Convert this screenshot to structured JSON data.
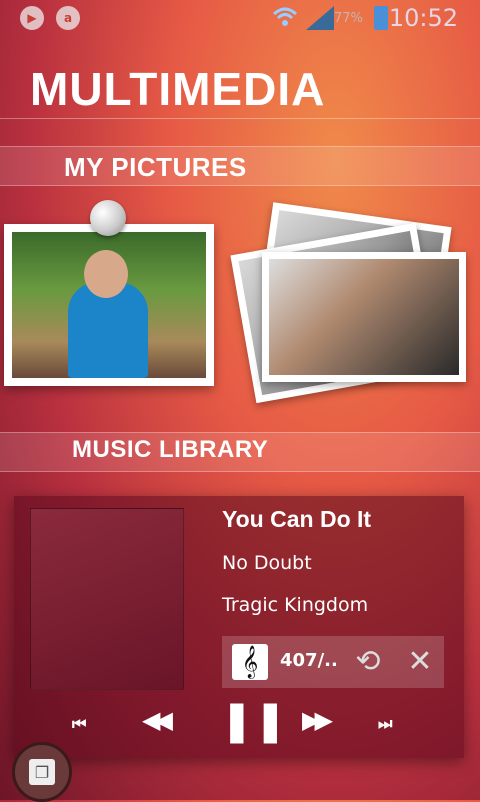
{
  "status_bar": {
    "battery_percent": "77%",
    "time": "10:52"
  },
  "page": {
    "title": "MULTIMEDIA"
  },
  "pictures": {
    "label": "MY PICTURES"
  },
  "music": {
    "label": "MUSIC LIBRARY",
    "track_title": "You Can Do It",
    "artist": "No Doubt",
    "album": "Tragic Kingdom",
    "track_count": "407/.."
  },
  "icons": {
    "clef": "𝄞",
    "repeat": "⟲",
    "shuffle": "✕",
    "skip_back": "⏮",
    "rewind": "◀◀",
    "pause": "❚❚",
    "fast_forward": "▶▶",
    "skip_forward": "⏭"
  },
  "colors": {
    "bg_top": "#f08a4a",
    "bg_mid": "#e65a45",
    "bg_bottom": "#6d1528"
  }
}
